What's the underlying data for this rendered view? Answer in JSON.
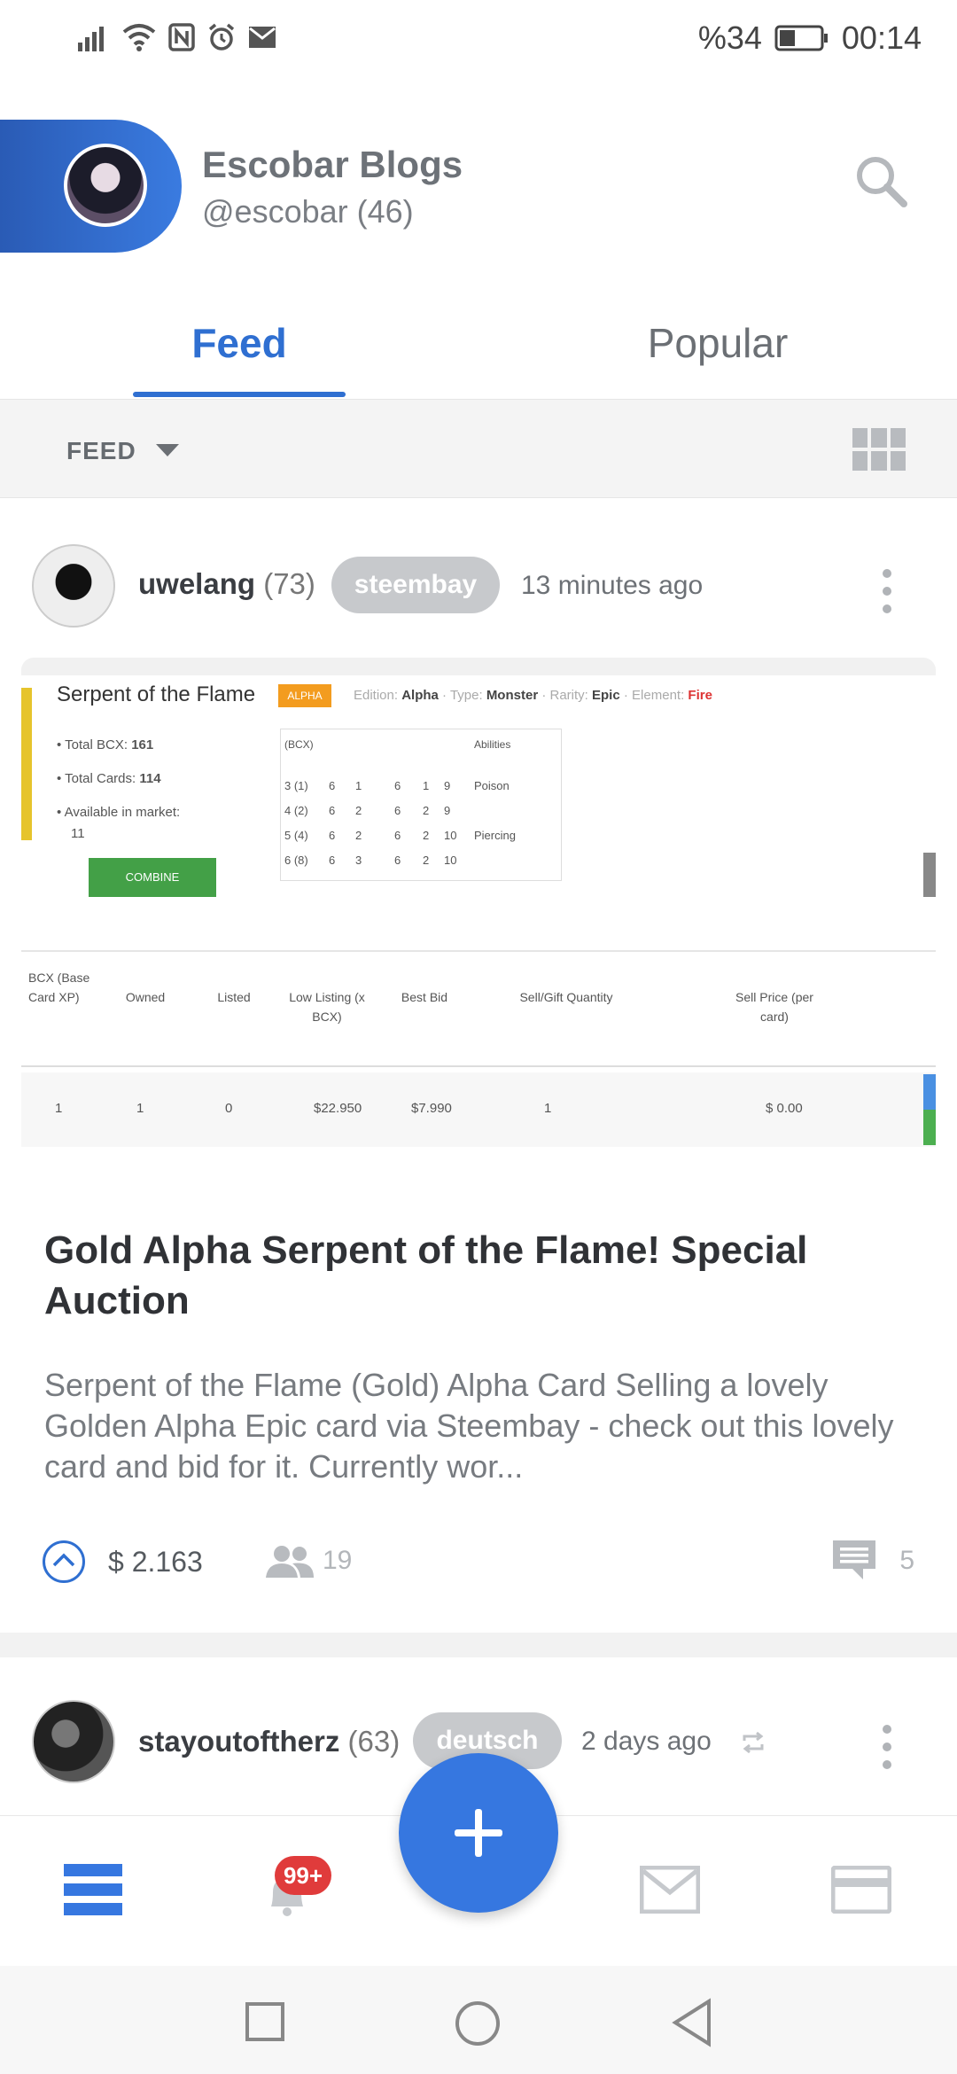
{
  "status_bar": {
    "battery_text": "%34",
    "time": "00:14",
    "left_icons": [
      "signal-icon",
      "wifi-icon",
      "nfc-icon",
      "alarm-icon",
      "mail-icon"
    ]
  },
  "header": {
    "name": "Escobar Blogs",
    "handle": "@escobar (46)"
  },
  "tabs": [
    {
      "label": "Feed",
      "active": true
    },
    {
      "label": "Popular",
      "active": false
    }
  ],
  "filter": {
    "label": "FEED"
  },
  "post1": {
    "author": "uwelang",
    "reputation": "(73)",
    "tag": "steembay",
    "time": "13 minutes ago",
    "title": "Gold Alpha Serpent of the Flame! Special Auction",
    "excerpt": "Serpent of the Flame (Gold) Alpha Card Selling a lovely Golden Alpha Epic card via Steembay - check out this lovely card and bid for it. Currently wor...",
    "payout": "$ 2.163",
    "voters": "19",
    "comments": "5",
    "image": {
      "card_title": "Serpent of the Flame",
      "badge": "ALPHA",
      "meta_edition_label": "Edition:",
      "meta_edition": "Alpha",
      "meta_type_label": "Type:",
      "meta_type": "Monster",
      "meta_rarity_label": "Rarity:",
      "meta_rarity": "Epic",
      "meta_element_label": "Element:",
      "meta_element": "Fire",
      "total_bcx_label": "Total BCX:",
      "total_bcx": "161",
      "total_cards_label": "Total Cards:",
      "total_cards": "114",
      "market_label": "Available in market:",
      "market_value": "11",
      "combine": "COMBINE",
      "stats_header": [
        "(BCX)",
        "",
        "",
        "",
        "",
        "",
        "Abilities"
      ],
      "stats_rows": [
        [
          "3 (1)",
          "6",
          "1",
          "6",
          "1",
          "9",
          "Poison"
        ],
        [
          "4 (2)",
          "6",
          "2",
          "6",
          "2",
          "9",
          ""
        ],
        [
          "5 (4)",
          "6",
          "2",
          "6",
          "2",
          "10",
          "Piercing"
        ],
        [
          "6 (8)",
          "6",
          "3",
          "6",
          "2",
          "10",
          ""
        ]
      ],
      "market_headers": [
        "BCX (Base Card XP)",
        "Owned",
        "Listed",
        "Low Listing (x BCX)",
        "Best Bid",
        "Sell/Gift Quantity",
        "Sell Price (per card)"
      ],
      "market_row": [
        "1",
        "1",
        "0",
        "$22.950",
        "$7.990",
        "1",
        "$ 0.00"
      ]
    }
  },
  "post2": {
    "author": "stayoutoftherz",
    "reputation": "(63)",
    "tag": "deutsch",
    "time": "2 days ago"
  },
  "bottom_nav": {
    "badge": "99+"
  },
  "colors": {
    "accent": "#2f6fd1",
    "fab": "#3677e0",
    "badge": "#e03b3b",
    "tag_pill": "#c7c9cc"
  }
}
